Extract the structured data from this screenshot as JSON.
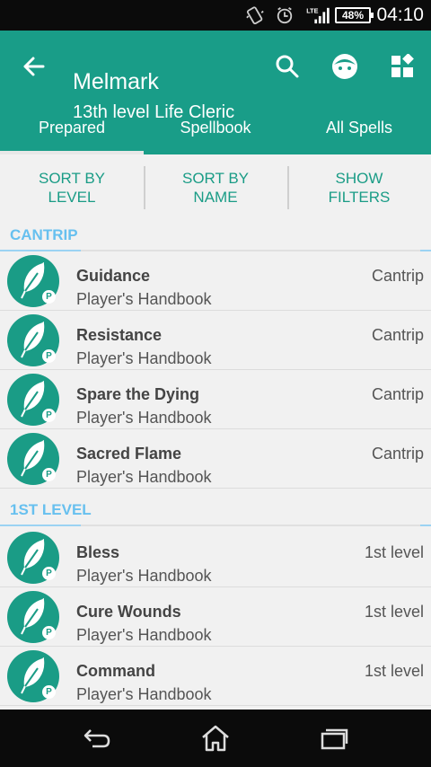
{
  "status_bar": {
    "time": "04:10",
    "battery": "48%",
    "icons": [
      "vibrate-icon",
      "alarm-icon",
      "lte-signal-icon",
      "battery-icon"
    ]
  },
  "app_bar": {
    "title": "Melmark",
    "subtitle": "13th level Life Cleric",
    "icons": [
      "back-arrow-icon",
      "search-icon",
      "character-face-icon",
      "dashboard-icon"
    ],
    "color": "#199d88"
  },
  "tabs": [
    {
      "label": "Prepared",
      "selected": true
    },
    {
      "label": "Spellbook",
      "selected": false
    },
    {
      "label": "All Spells",
      "selected": false
    }
  ],
  "sort_bar": {
    "sort_level": "SORT BY\nLEVEL",
    "sort_name": "SORT BY\nNAME",
    "show_filters": "SHOW\nFILTERS"
  },
  "sections": [
    {
      "header": "CANTRIP",
      "spells": [
        {
          "name": "Guidance",
          "source": "Player's Handbook",
          "level": "Cantrip",
          "badge": "P"
        },
        {
          "name": "Resistance",
          "source": "Player's Handbook",
          "level": "Cantrip",
          "badge": "P"
        },
        {
          "name": "Spare the Dying",
          "source": "Player's Handbook",
          "level": "Cantrip",
          "badge": "P"
        },
        {
          "name": "Sacred Flame",
          "source": "Player's Handbook",
          "level": "Cantrip",
          "badge": "P"
        }
      ]
    },
    {
      "header": "1ST LEVEL",
      "spells": [
        {
          "name": "Bless",
          "source": "Player's Handbook",
          "level": "1st level",
          "badge": "P"
        },
        {
          "name": "Cure Wounds",
          "source": "Player's Handbook",
          "level": "1st level",
          "badge": "P"
        },
        {
          "name": "Command",
          "source": "Player's Handbook",
          "level": "1st level",
          "badge": "P"
        }
      ]
    }
  ],
  "nav_bar": {
    "icons": [
      "back-icon",
      "home-icon",
      "recent-apps-icon"
    ]
  }
}
